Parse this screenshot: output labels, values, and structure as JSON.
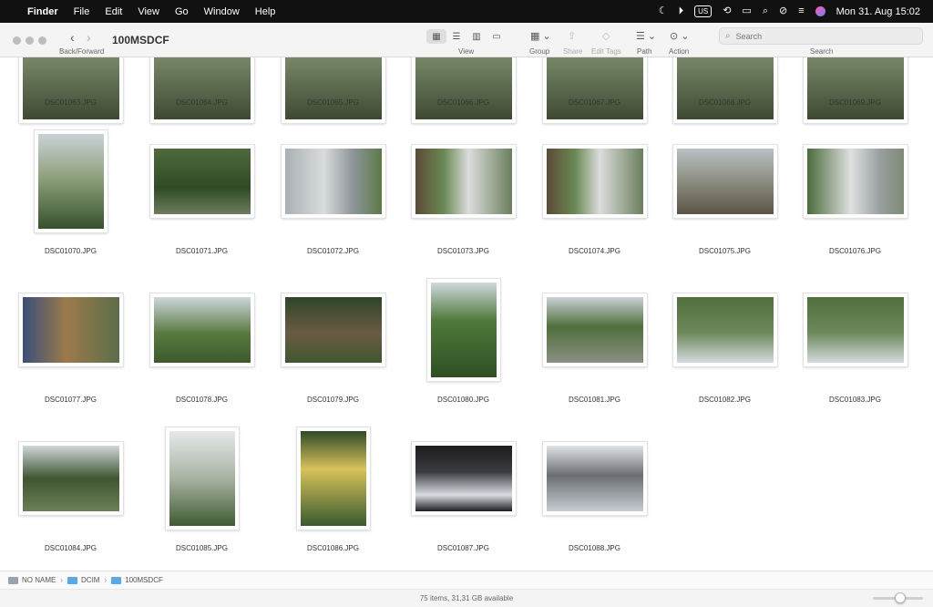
{
  "menubar": {
    "app_name": "Finder",
    "items": [
      "File",
      "Edit",
      "View",
      "Go",
      "Window",
      "Help"
    ],
    "keyboard_layout": "US",
    "datetime": "Mon 31. Aug  15:02"
  },
  "toolbar": {
    "title": "100MSDCF",
    "back_forward_label": "Back/Forward",
    "view_label": "View",
    "group_label": "Group",
    "share_label": "Share",
    "edit_tags_label": "Edit Tags",
    "path_label": "Path",
    "action_label": "Action",
    "search_label": "Search",
    "search_placeholder": "Search"
  },
  "files": [
    {
      "name": "DSC01063.JPG",
      "orientation": "landscape"
    },
    {
      "name": "DSC01064.JPG",
      "orientation": "landscape"
    },
    {
      "name": "DSC01065.JPG",
      "orientation": "landscape"
    },
    {
      "name": "DSC01066.JPG",
      "orientation": "landscape"
    },
    {
      "name": "DSC01067.JPG",
      "orientation": "landscape"
    },
    {
      "name": "DSC01068.JPG",
      "orientation": "landscape"
    },
    {
      "name": "DSC01069.JPG",
      "orientation": "landscape"
    },
    {
      "name": "DSC01070.JPG",
      "orientation": "portrait",
      "scene": "sign-post"
    },
    {
      "name": "DSC01071.JPG",
      "orientation": "landscape",
      "scene": "sign-garden"
    },
    {
      "name": "DSC01072.JPG",
      "orientation": "landscape",
      "scene": "pole-poster"
    },
    {
      "name": "DSC01073.JPG",
      "orientation": "landscape",
      "scene": "pole-poster-trees"
    },
    {
      "name": "DSC01074.JPG",
      "orientation": "landscape",
      "scene": "pole-poster-trees"
    },
    {
      "name": "DSC01075.JPG",
      "orientation": "landscape",
      "scene": "tree-stump"
    },
    {
      "name": "DSC01076.JPG",
      "orientation": "landscape",
      "scene": "pole-poster-road"
    },
    {
      "name": "DSC01077.JPG",
      "orientation": "landscape",
      "scene": "board-car"
    },
    {
      "name": "DSC01078.JPG",
      "orientation": "landscape",
      "scene": "park-signs"
    },
    {
      "name": "DSC01079.JPG",
      "orientation": "landscape",
      "scene": "bench"
    },
    {
      "name": "DSC01080.JPG",
      "orientation": "portrait",
      "scene": "bush-signs"
    },
    {
      "name": "DSC01081.JPG",
      "orientation": "landscape",
      "scene": "park-trees"
    },
    {
      "name": "DSC01082.JPG",
      "orientation": "landscape",
      "scene": "park-newspaper"
    },
    {
      "name": "DSC01083.JPG",
      "orientation": "landscape",
      "scene": "park-newspaper"
    },
    {
      "name": "DSC01084.JPG",
      "orientation": "landscape",
      "scene": "notice-board"
    },
    {
      "name": "DSC01085.JPG",
      "orientation": "portrait",
      "scene": "sign-boards"
    },
    {
      "name": "DSC01086.JPG",
      "orientation": "portrait",
      "scene": "yellow-sign"
    },
    {
      "name": "DSC01087.JPG",
      "orientation": "landscape",
      "scene": "dark-newspaper"
    },
    {
      "name": "DSC01088.JPG",
      "orientation": "landscape",
      "scene": "newspaper-bag"
    }
  ],
  "pathbar": {
    "crumbs": [
      {
        "label": "NO NAME",
        "icon": "drive-icon"
      },
      {
        "label": "DCIM",
        "icon": "folder-icon"
      },
      {
        "label": "100MSDCF",
        "icon": "folder-icon"
      }
    ]
  },
  "statusbar": {
    "text": "75 items, 31,31 GB available",
    "icon_size_fraction": 0.55
  }
}
